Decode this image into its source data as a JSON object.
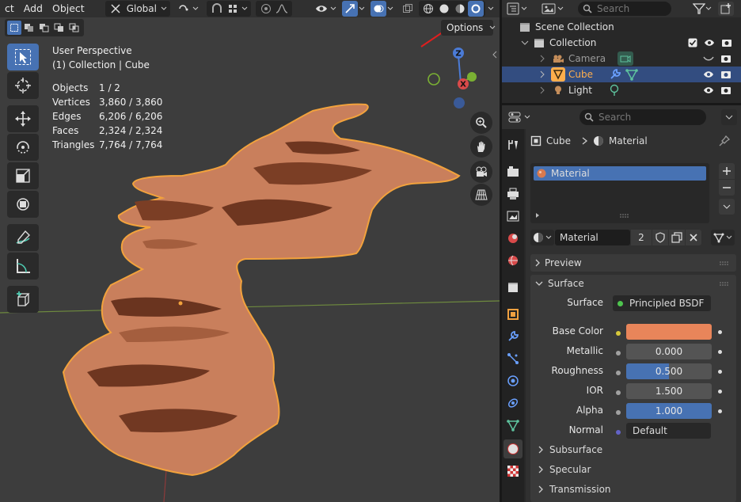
{
  "viewport": {
    "menus": [
      "ct",
      "Add",
      "Object"
    ],
    "transform_orientation": "Global",
    "options_label": "Options",
    "view_name": "User Perspective",
    "collection_line": "(1) Collection | Cube",
    "stats": [
      {
        "label": "Objects",
        "value": "1 / 2"
      },
      {
        "label": "Vertices",
        "value": "3,860 / 3,860"
      },
      {
        "label": "Edges",
        "value": "6,206 / 6,206"
      },
      {
        "label": "Faces",
        "value": "2,324 / 2,324"
      },
      {
        "label": "Triangles",
        "value": "7,764 / 7,764"
      }
    ],
    "gizmo_labels": {
      "z": "Z",
      "x": "X"
    },
    "mesh_color": "#c97f5c",
    "outline_color": "#f2a23c",
    "active_shading": "rendered"
  },
  "outliner": {
    "search_placeholder": "Search",
    "scene_collection": "Scene Collection",
    "items": [
      {
        "name": "Collection",
        "type": "collection"
      },
      {
        "name": "Camera",
        "type": "camera"
      },
      {
        "name": "Cube",
        "type": "mesh",
        "selected": true
      },
      {
        "name": "Light",
        "type": "light"
      }
    ]
  },
  "properties": {
    "search_placeholder": "Search",
    "breadcrumb": {
      "object": "Cube",
      "material": "Material"
    },
    "slots": [
      "Material"
    ],
    "material_name": "Material",
    "users": "2",
    "panels": {
      "preview": "Preview",
      "surface": "Surface",
      "subsurface": "Subsurface",
      "specular": "Specular",
      "transmission": "Transmission"
    },
    "surface_fields": {
      "surface_label": "Surface",
      "surface_value": "Principled BSDF",
      "base_color_label": "Base Color",
      "base_color": "#e8855a",
      "metallic_label": "Metallic",
      "metallic": "0.000",
      "roughness_label": "Roughness",
      "roughness": "0.500",
      "roughness_fraction": 0.5,
      "ior_label": "IOR",
      "ior": "1.500",
      "alpha_label": "Alpha",
      "alpha": "1.000",
      "alpha_fraction": 1.0,
      "normal_label": "Normal",
      "normal": "Default"
    }
  }
}
